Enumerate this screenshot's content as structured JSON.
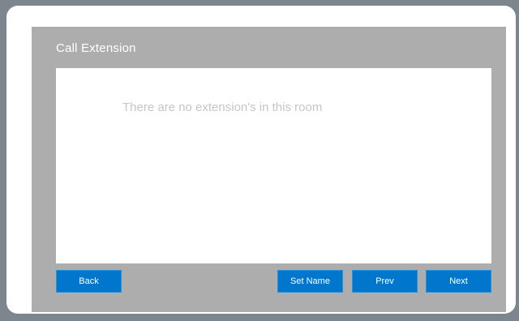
{
  "panel": {
    "title": "Call Extension"
  },
  "content": {
    "empty_message": "There are no extension's in this room"
  },
  "buttons": {
    "back_label": "Back",
    "set_name_label": "Set Name",
    "prev_label": "Prev",
    "next_label": "Next"
  },
  "colors": {
    "background": "#7d858e",
    "frame": "#ffffff",
    "panel": "#acadac",
    "button": "#0077cc",
    "message_text": "#c6c6c6"
  }
}
